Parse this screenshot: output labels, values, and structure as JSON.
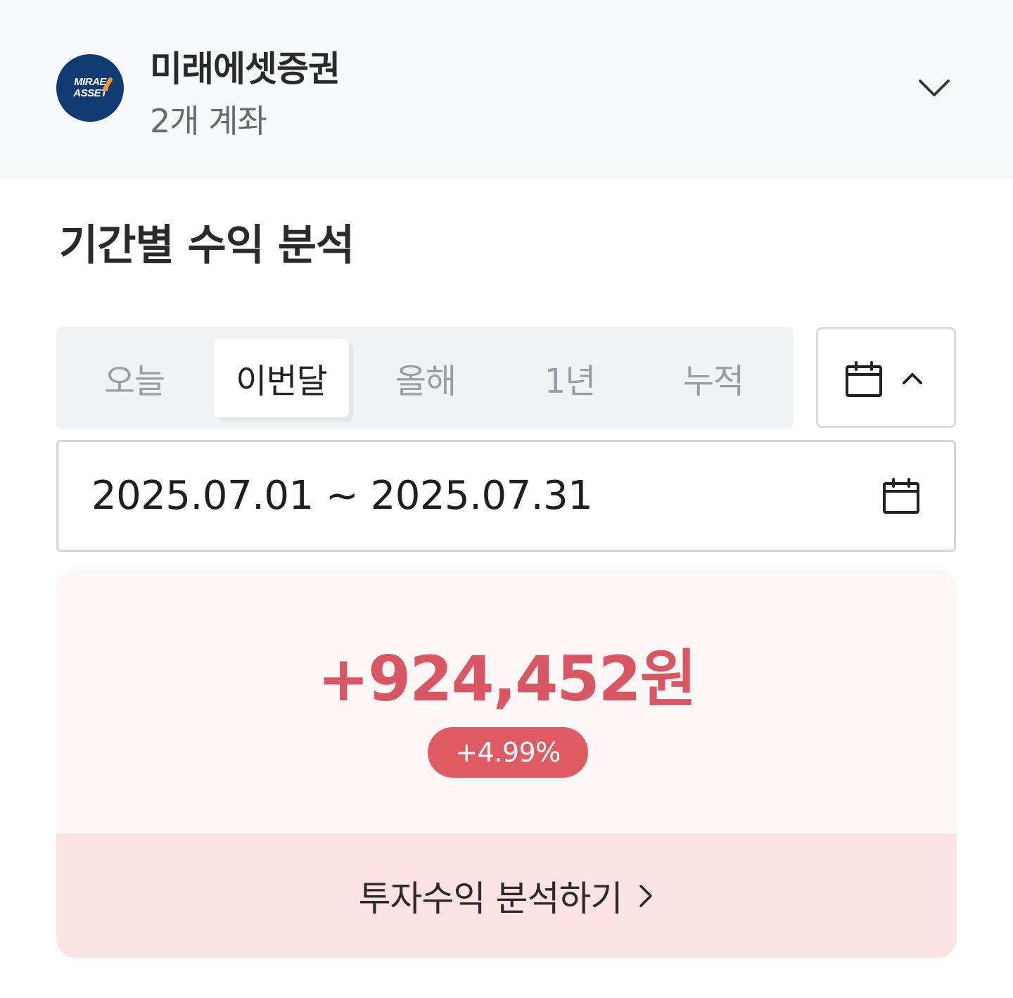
{
  "header": {
    "logo_line1": "MIRAE",
    "logo_line2": "ASSET",
    "broker_name": "미래에셋증권",
    "account_count": "2개 계좌",
    "expand_icon": "chevron-down-icon"
  },
  "section": {
    "title": "기간별 수익 분석"
  },
  "period_tabs": {
    "items": [
      {
        "label": "오늘",
        "active": false
      },
      {
        "label": "이번달",
        "active": true
      },
      {
        "label": "올해",
        "active": false
      },
      {
        "label": "1년",
        "active": false
      },
      {
        "label": "누적",
        "active": false
      }
    ],
    "calendar_toggle_icons": [
      "calendar-icon",
      "chevron-up-icon"
    ]
  },
  "date_range": {
    "text": "2025.07.01 ~ 2025.07.31",
    "icon": "calendar-icon"
  },
  "profit": {
    "amount": "+924,452원",
    "rate": "+4.99%",
    "link_label": "투자수익 분석하기",
    "link_icon": "chevron-right-icon",
    "colors": {
      "amount": "#d95763",
      "badge_bg": "#e05a64",
      "card_bg": "#fdf6f7",
      "link_bg": "#fde2e4"
    }
  }
}
